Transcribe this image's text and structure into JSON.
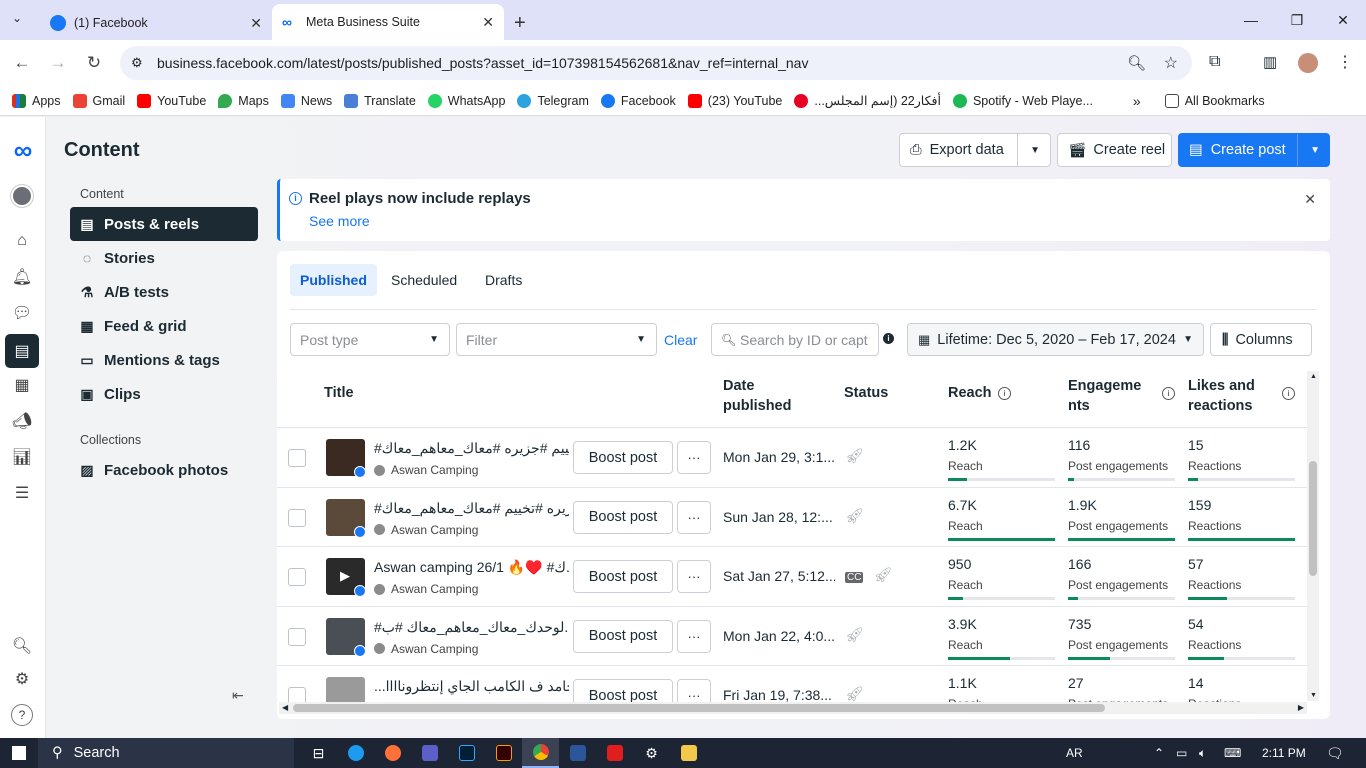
{
  "browser": {
    "tabs": [
      {
        "title": "(1) Facebook",
        "active": false
      },
      {
        "title": "Meta Business Suite",
        "active": true
      }
    ],
    "url": "business.facebook.com/latest/posts/published_posts?asset_id=107398154562681&nav_ref=internal_nav",
    "bookmarks": [
      "Apps",
      "Gmail",
      "YouTube",
      "Maps",
      "News",
      "Translate",
      "WhatsApp",
      "Telegram",
      "Facebook",
      "(23) YouTube",
      "أفكار22 (إسم المجلس...",
      "Spotify - Web Playe..."
    ],
    "all_bookmarks": "All Bookmarks"
  },
  "page": {
    "title": "Content",
    "export_label": "Export data",
    "create_reel_label": "Create reel",
    "create_post_label": "Create post"
  },
  "sidebar": {
    "content_heading": "Content",
    "items": [
      {
        "label": "Posts & reels",
        "icon": "posts-icon",
        "active": true
      },
      {
        "label": "Stories",
        "icon": "stories-icon"
      },
      {
        "label": "A/B tests",
        "icon": "ab-test-icon"
      },
      {
        "label": "Feed & grid",
        "icon": "grid-icon"
      },
      {
        "label": "Mentions & tags",
        "icon": "mentions-icon"
      },
      {
        "label": "Clips",
        "icon": "clips-icon"
      }
    ],
    "collections_heading": "Collections",
    "collections": [
      {
        "label": "Facebook photos",
        "icon": "photos-icon"
      }
    ]
  },
  "banner": {
    "title": "Reel plays now include replays",
    "link": "See more"
  },
  "tabs": [
    "Published",
    "Scheduled",
    "Drafts"
  ],
  "filters": {
    "post_type_placeholder": "Post type",
    "filter_placeholder": "Filter",
    "clear_label": "Clear",
    "search_placeholder": "Search by ID or caption",
    "date_range": "Lifetime: Dec 5, 2020 – Feb 17, 2024",
    "columns_label": "Columns"
  },
  "table": {
    "headers": {
      "title": "Title",
      "date": "Date published",
      "status": "Status",
      "reach": "Reach",
      "engagements": "Engagements",
      "likes": "Likes and reactions"
    },
    "boost_label": "Boost post",
    "more_label": "···",
    "rows": [
      {
        "title": "#تخييم #جزيره #معاك_معاهم_معاك",
        "account": "Aswan Camping",
        "date": "Mon Jan 29, 3:1...",
        "reach": "1.2K",
        "reach_label": "Reach",
        "reach_fill": 0.18,
        "eng": "116",
        "eng_label": "Post engagements",
        "eng_fill": 0.06,
        "likes": "15",
        "likes_label": "Reactions",
        "likes_fill": 0.09,
        "thumb": "#3b2a22",
        "video": false
      },
      {
        "title": "#جزيره #تخييم #معاك_معاهم_معاك",
        "account": "Aswan Camping",
        "date": "Sun Jan 28, 12:...",
        "reach": "6.7K",
        "reach_label": "Reach",
        "reach_fill": 1.0,
        "eng": "1.9K",
        "eng_label": "Post engagements",
        "eng_fill": 1.0,
        "likes": "159",
        "likes_label": "Reactions",
        "likes_fill": 1.0,
        "thumb": "#5b4a3a",
        "video": false
      },
      {
        "title": "Aswan camping 26/1 🔥♥️ #ك...",
        "account": "Aswan Camping",
        "date": "Sat Jan 27, 5:12...",
        "reach": "950",
        "reach_label": "Reach",
        "reach_fill": 0.14,
        "eng": "166",
        "eng_label": "Post engagements",
        "eng_fill": 0.09,
        "likes": "57",
        "likes_label": "Reactions",
        "likes_fill": 0.36,
        "thumb": "#2a2a2a",
        "video": true
      },
      {
        "title": "#لوحدك_معاك_معاهم_معاك #ب...",
        "account": "Aswan Camping",
        "date": "Mon Jan 22, 4:0...",
        "reach": "3.9K",
        "reach_label": "Reach",
        "reach_fill": 0.58,
        "eng": "735",
        "eng_label": "Post engagements",
        "eng_fill": 0.39,
        "likes": "54",
        "likes_label": "Reactions",
        "likes_fill": 0.34,
        "thumb": "#4a4e55",
        "video": false
      },
      {
        "title": "...جامد ف الكامب الجاي إنتظروناااا",
        "account": "Aswan Camping",
        "date": "Fri Jan 19, 7:38...",
        "reach": "1.1K",
        "reach_label": "Reach",
        "reach_fill": 0.16,
        "eng": "27",
        "eng_label": "Post engagements",
        "eng_fill": 0.01,
        "likes": "14",
        "likes_label": "Reactions",
        "likes_fill": 0.09,
        "thumb": "#9a9a9a",
        "video": false
      }
    ]
  },
  "taskbar": {
    "search_label": "Search",
    "lang": "AR",
    "time": "2:11 PM"
  },
  "colors": {
    "accent": "#1877f2",
    "bar": "#0c8a5c",
    "dark": "#1c2b33"
  }
}
